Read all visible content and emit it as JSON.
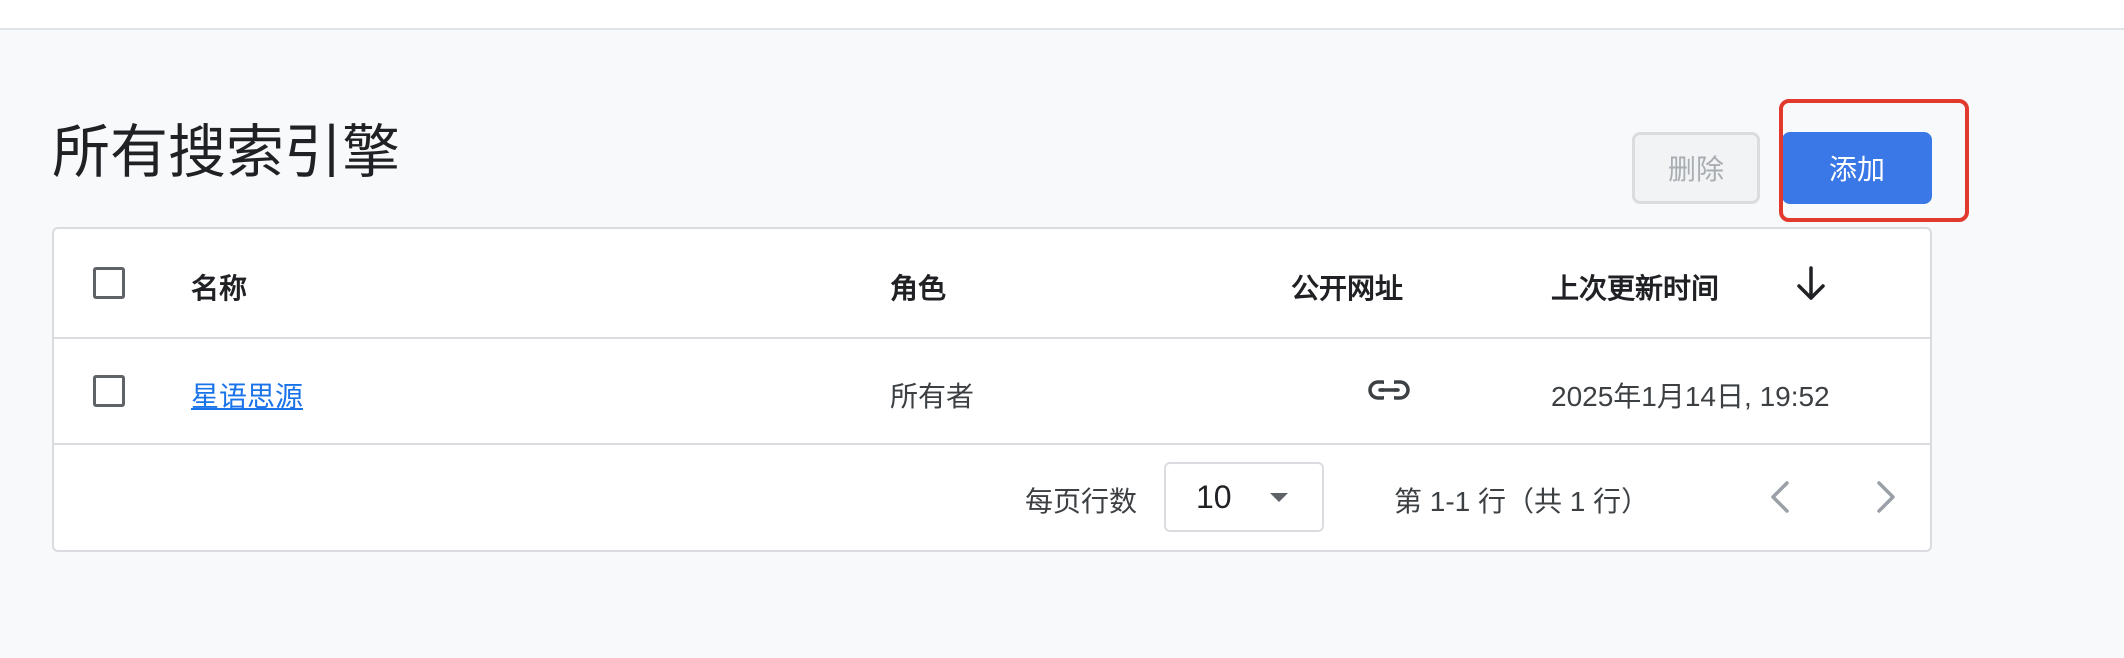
{
  "page": {
    "title": "所有搜索引擎"
  },
  "toolbar": {
    "delete_label": "删除",
    "add_label": "添加"
  },
  "table": {
    "columns": {
      "name": "名称",
      "role": "角色",
      "public_url": "公开网址",
      "last_updated": "上次更新时间"
    },
    "sort": {
      "column": "last_updated",
      "direction": "descending",
      "icon": "arrow-down-icon"
    },
    "rows": [
      {
        "name": "星语思源",
        "role": "所有者",
        "public_url_icon": "link-icon",
        "last_updated": "2025年1月14日, 19:52"
      }
    ]
  },
  "pagination": {
    "rows_per_page_label": "每页行数",
    "rows_per_page_value": "10",
    "range_text": "第 1-1 行（共 1 行）",
    "prev_icon": "chevron-left-icon",
    "next_icon": "chevron-right-icon"
  },
  "colors": {
    "accent": "#3b78e7",
    "link": "#1a73e8",
    "highlight": "#e1392e",
    "background": "#f8f9fa"
  }
}
